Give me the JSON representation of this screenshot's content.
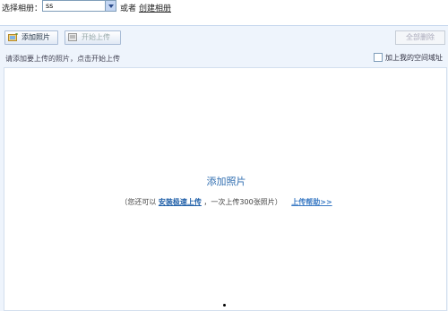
{
  "topbar": {
    "album_label": "选择相册：",
    "album_value": "ss",
    "or_text": "或者",
    "create_album_link": "创建相册"
  },
  "toolbar": {
    "add_photo_button": "添加照片",
    "start_upload_button": "开始上传",
    "clear_all_button": "全部删除"
  },
  "hint_text": "请添加要上传的照片，点击开始上传",
  "watermark_option": {
    "checked": false,
    "label": "加上我的空间域址"
  },
  "droparea": {
    "add_photo_title": "添加照片",
    "tip_prefix": "（您还可以",
    "tip_install_link": "安装极速上传",
    "tip_middle": "，一次上传300张照片）",
    "help_link": "上传帮助>>"
  },
  "colors": {
    "panel_bg": "#eef4fc",
    "link_blue": "#2f6db0"
  }
}
